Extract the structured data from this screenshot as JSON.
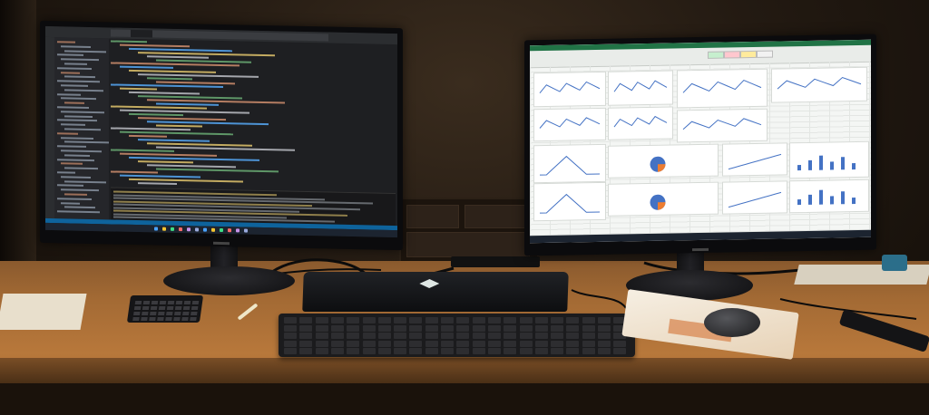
{
  "scene": {
    "monitor_left": {
      "content": "code-editor",
      "brand_label": ""
    },
    "monitor_right": {
      "content": "spreadsheet-dashboard",
      "brand_label": ""
    }
  },
  "colors": {
    "editor_bg": "#1e1f22",
    "code_green": "#6aab73",
    "code_orange": "#cf8e6d",
    "code_blue": "#56a8f5",
    "code_yellow": "#e0c46c",
    "spreadsheet_green": "#217346",
    "desk_wood": "#a36a34"
  }
}
